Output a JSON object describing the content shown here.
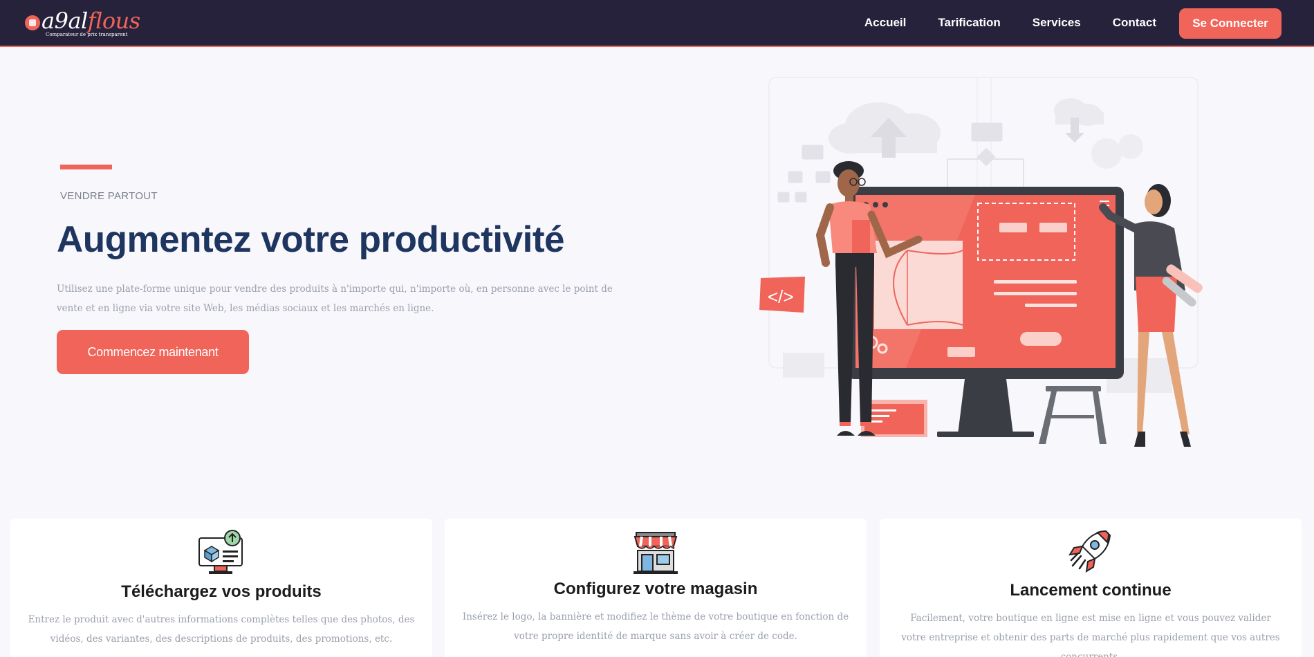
{
  "brand": {
    "name_part1": "a9al",
    "name_part2": "flous",
    "tagline": "Comparateur de prix transparent",
    "accent_color": "#f0645a",
    "nav_bg_color": "#26223c"
  },
  "nav": {
    "links": [
      "Accueil",
      "Tarification",
      "Services",
      "Contact"
    ],
    "login_label": "Se Connecter"
  },
  "hero": {
    "eyebrow": "VENDRE PARTOUT",
    "title": "Augmentez votre productivité",
    "description": "Utilisez une plate-forme unique pour vendre des produits à n'importe qui, n'importe où, en personne avec le point de vente et en ligne via votre site Web, les médias sociaux et les marchés en ligne.",
    "cta_label": "Commencez maintenant",
    "title_color": "#1e3560"
  },
  "features": [
    {
      "icon": "monitor-upload-icon",
      "title": "Téléchargez vos produits",
      "text": "Entrez le produit avec d'autres informations complètes telles que des photos, des vidéos, des variantes, des descriptions de produits, des promotions, etc."
    },
    {
      "icon": "storefront-icon",
      "title": "Configurez votre magasin",
      "text": "Insérez le logo, la bannière et modifiez le thème de votre boutique en fonction de votre propre identité de marque sans avoir à créer de code."
    },
    {
      "icon": "rocket-icon",
      "title": "Lancement continue",
      "text": "Facilement, votre boutique en ligne est mise en ligne et vous pouvez valider votre entreprise et obtenir des parts de marché plus rapidement que vos autres concurrents."
    }
  ]
}
